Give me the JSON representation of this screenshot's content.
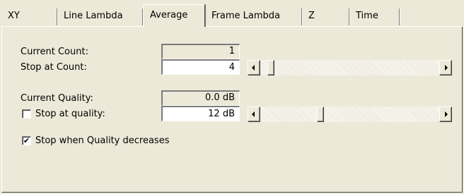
{
  "tabs": [
    {
      "label": "XY"
    },
    {
      "label": "Line Lambda"
    },
    {
      "label": "Average"
    },
    {
      "label": "Frame Lambda"
    },
    {
      "label": "Z"
    },
    {
      "label": "Time"
    }
  ],
  "active_tab": "Average",
  "average": {
    "current_count": {
      "label": "Current Count:",
      "value": "1"
    },
    "stop_at_count": {
      "label": "Stop at Count:",
      "value": "4",
      "slider_level": 0.0
    },
    "current_quality": {
      "label": "Current Quality:",
      "value": "0.0 dB"
    },
    "stop_at_quality": {
      "label": "Stop at quality:",
      "checked": false,
      "value": "12 dB",
      "slider_level": 0.25
    },
    "stop_when_decreases": {
      "label": "Stop when Quality decreases",
      "checked": true
    }
  },
  "colors": {
    "window_bg": "#ece9d8",
    "field_bg": "#ffffff"
  },
  "icons": {
    "checkmark": "check-icon",
    "scroll_left": "arrow-left-icon",
    "scroll_right": "arrow-right-icon"
  }
}
